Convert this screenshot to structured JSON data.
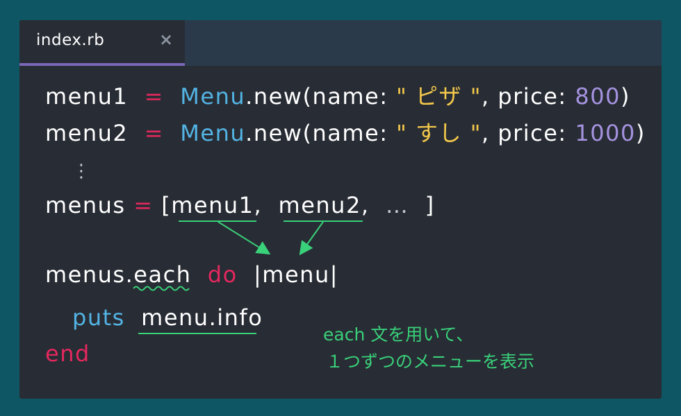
{
  "tab": {
    "title": "index.rb",
    "close": "×"
  },
  "code": {
    "l1": {
      "var": "menu1",
      "eq": "=",
      "cls": "Menu",
      "call": ".new(name:",
      "str": "\" ピザ \"",
      "comma": ",",
      "key": "price:",
      "num": "800",
      "close": ")"
    },
    "l2": {
      "var": "menu2",
      "eq": "=",
      "cls": "Menu",
      "call": ".new(name:",
      "str": "\" すし \"",
      "comma": ",",
      "key": "price:",
      "num": "1000",
      "close": ")"
    },
    "ellipsis": "⋮",
    "l3": {
      "var": "menus",
      "eq": "=",
      "open": "[",
      "item1": "menu1",
      "sep1": ",",
      "item2": "menu2",
      "sep2": ",",
      "rest": "…",
      "close": "]"
    },
    "l4": {
      "obj": "menus.",
      "method": "each",
      "kw": "do",
      "param": "|menu|"
    },
    "l5": {
      "fn": "puts",
      "arg": "menu.info"
    },
    "l6": {
      "kw": "end"
    }
  },
  "note": {
    "line1": "each 文を用いて、",
    "line2": "１つずつのメニューを表示"
  },
  "colors": {
    "background": "#0e5663",
    "editor": "#282c34",
    "tabbar": "#2b3a4a",
    "tab_accent": "#7a67b8",
    "keyword": "#e4285e",
    "class": "#53b4e4",
    "string": "#f3c84b",
    "number": "#a593e0",
    "annotation": "#39d17a"
  }
}
